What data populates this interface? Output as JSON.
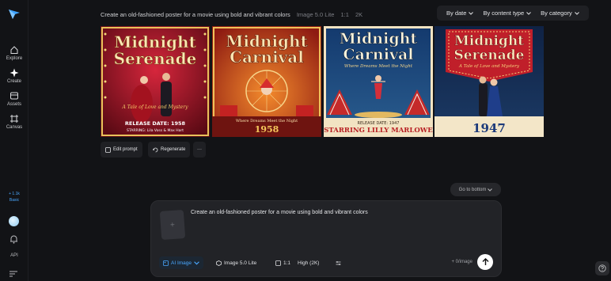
{
  "sidebar": {
    "items": [
      {
        "label": "Explore",
        "icon": "home-icon"
      },
      {
        "label": "Create",
        "icon": "sparkle-icon"
      },
      {
        "label": "Assets",
        "icon": "folder-icon"
      },
      {
        "label": "Canvas",
        "icon": "canvas-icon"
      }
    ],
    "credits_line1": "+ 1.1k",
    "credits_line2": "Basic",
    "api_label": "API"
  },
  "header": {
    "prompt": "Create an old-fashioned poster for a movie using bold and vibrant colors",
    "model": "Image 5.0 Lite",
    "ratio": "1:1",
    "resolution": "2K"
  },
  "filters": {
    "date": "By date",
    "content_type": "By content type",
    "category": "By category"
  },
  "posters": [
    {
      "title_line1": "Midnight",
      "title_line2": "Serenade",
      "subtitle": "A Tale of Love and Mystery",
      "release": "RELEASE DATE: 1958",
      "credits": "STARRING: Lila Voss & Max Hart"
    },
    {
      "title_line1": "Midnight",
      "title_line2": "Carnival",
      "subtitle": "Where Dreams Meet the Night",
      "release": "1958"
    },
    {
      "title_line1": "Midnight",
      "title_line2": "Carnival",
      "subtitle": "Where Dreams Meet the Night",
      "release": "RELEASE DATE: 1947",
      "credits": "STARRING LILLY MARLOWE"
    },
    {
      "title_line1": "Midnight",
      "title_line2": "Serenade",
      "subtitle": "A Tale of Love and Mystery",
      "release": "1947"
    }
  ],
  "actions": {
    "edit_prompt": "Edit prompt",
    "regenerate": "Regenerate",
    "more": "···"
  },
  "go_to_bottom": "Go to bottom",
  "composer": {
    "text": "Create an old-fashioned poster for a movie using bold and vibrant colors",
    "mode": "AI Image",
    "model": "Image 5.0 Lite",
    "ratio": "1:1",
    "quality": "High (2K)",
    "cost": "+ 0/image"
  },
  "colors": {
    "accent": "#4aa8ff",
    "background": "#121316",
    "panel": "#222327"
  }
}
